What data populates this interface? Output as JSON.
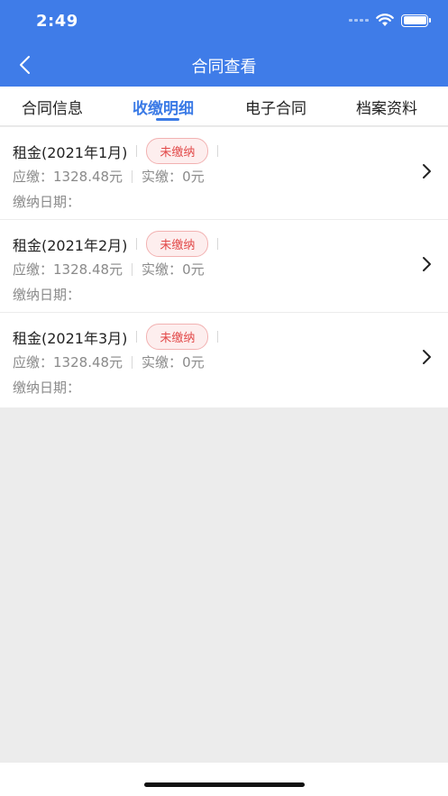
{
  "status_bar": {
    "time": "2:49"
  },
  "nav": {
    "title": "合同查看"
  },
  "tabs": [
    {
      "label": "合同信息",
      "active": false
    },
    {
      "label": "收缴明细",
      "active": true
    },
    {
      "label": "电子合同",
      "active": false
    },
    {
      "label": "档案资料",
      "active": false
    }
  ],
  "items": [
    {
      "title": "租金(2021年1月)",
      "status": "未缴纳",
      "due_label": "应缴：",
      "due_value": "1328.48元",
      "paid_label": "实缴：",
      "paid_value": "0元",
      "date_label": "缴纳日期："
    },
    {
      "title": "租金(2021年2月)",
      "status": "未缴纳",
      "due_label": "应缴：",
      "due_value": "1328.48元",
      "paid_label": "实缴：",
      "paid_value": "0元",
      "date_label": "缴纳日期："
    },
    {
      "title": "租金(2021年3月)",
      "status": "未缴纳",
      "due_label": "应缴：",
      "due_value": "1328.48元",
      "paid_label": "实缴：",
      "paid_value": "0元",
      "date_label": "缴纳日期："
    }
  ],
  "colors": {
    "header": "#3f7ce8",
    "accent": "#3a7ae6",
    "unpaid": "#e24a4a"
  }
}
